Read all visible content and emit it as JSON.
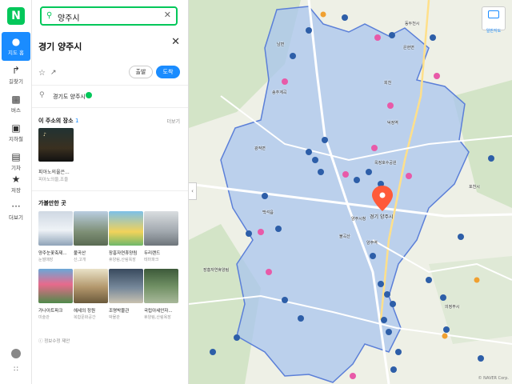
{
  "rail": {
    "logo": "N",
    "items": [
      {
        "label": "지도 홈",
        "icon": "map-pin-icon"
      },
      {
        "label": "길찾기",
        "icon": "directions-icon"
      },
      {
        "label": "버스",
        "icon": "bus-icon"
      },
      {
        "label": "지하철",
        "icon": "subway-icon"
      },
      {
        "label": "기차",
        "icon": "train-icon"
      },
      {
        "label": "저장",
        "icon": "star-icon"
      },
      {
        "label": "더보기",
        "icon": "more-icon"
      }
    ]
  },
  "search": {
    "value": "양주시",
    "icon": "search-icon",
    "clear_icon": "close-icon"
  },
  "place": {
    "title": "경기 양주시",
    "start_label": "출발",
    "arrive_label": "도착",
    "address": "경기도 양주시"
  },
  "section_places": {
    "title": "이 주소의 장소",
    "count": "1",
    "more": "더보기",
    "item": {
      "name": "피아노의울은...",
      "sub": "피아노의울,조을"
    }
  },
  "section_nearby": {
    "title": "가볼만한 곳",
    "items": [
      {
        "name": "양주눈꽃축제...",
        "sub": "눈썰매장"
      },
      {
        "name": "불곡산",
        "sub": "산,고개"
      },
      {
        "name": "장흥자연휴양림",
        "sub": "휴양림,산림욕장"
      },
      {
        "name": "두리랜드",
        "sub": "테마파크"
      },
      {
        "name": "가나아트파크",
        "sub": "미술관"
      },
      {
        "name": "헤세의 정원",
        "sub": "복합문화공간"
      },
      {
        "name": "조명박물관",
        "sub": "박물관"
      },
      {
        "name": "국립아세안자...",
        "sub": "휴양림,산림욕장"
      }
    ]
  },
  "report_text": "정보수정 제안",
  "map": {
    "colors": {
      "region": "#a9c6ee",
      "border": "#5b7fd8",
      "road": "#ffffff",
      "green": "#d3e4c7",
      "pin": "#ff5a3a",
      "poi_blue": "#2d5ea8",
      "poi_pink": "#e85aa8"
    },
    "pin_label": "경기 양주시",
    "layer_button": "일반지도",
    "copyright": "© NAVER Corp.",
    "labels": [
      {
        "text": "송추계곡"
      },
      {
        "text": "장흥자연휴양림"
      },
      {
        "text": "양주시청"
      },
      {
        "text": "옥정호수공원"
      },
      {
        "text": "덕정역"
      },
      {
        "text": "회천"
      },
      {
        "text": "백석읍"
      },
      {
        "text": "광적면"
      },
      {
        "text": "은현면"
      },
      {
        "text": "남면"
      },
      {
        "text": "동두천시"
      },
      {
        "text": "의정부시"
      },
      {
        "text": "포천시"
      },
      {
        "text": "불곡산"
      },
      {
        "text": "양주역"
      }
    ]
  }
}
